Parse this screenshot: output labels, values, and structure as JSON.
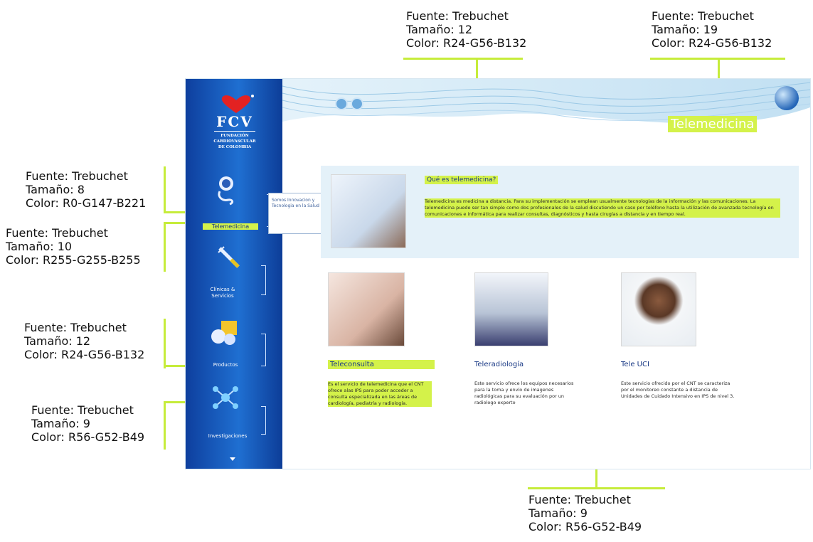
{
  "annotations": [
    {
      "id": "a1",
      "lines": [
        "Fuente: Trebuchet",
        "Tamaño: 12",
        "Color: R24-G56-B132"
      ]
    },
    {
      "id": "a2",
      "lines": [
        "Fuente: Trebuchet",
        "Tamaño: 19",
        "Color: R24-G56-B132"
      ]
    },
    {
      "id": "a3",
      "lines": [
        "Fuente: Trebuchet",
        "Tamaño: 8",
        "Color: R0-G147-B221"
      ]
    },
    {
      "id": "a4",
      "lines": [
        "Fuente: Trebuchet",
        "Tamaño: 10",
        "Color: R255-G255-B255"
      ]
    },
    {
      "id": "a5",
      "lines": [
        "Fuente: Trebuchet",
        "Tamaño: 12",
        "Color: R24-G56-B132"
      ]
    },
    {
      "id": "a6",
      "lines": [
        "Fuente: Trebuchet",
        "Tamaño: 9",
        "Color: R56-G52-B49"
      ]
    },
    {
      "id": "a7",
      "lines": [
        "Fuente: Trebuchet",
        "Tamaño: 9",
        "Color: R56-G52-B49"
      ]
    }
  ],
  "logo": {
    "name": "FCV",
    "subtitle": [
      "FUNDACIÓN",
      "CARDIOVASCULAR",
      "DE COLOMBIA"
    ]
  },
  "nav": [
    {
      "label": "Telemedicina",
      "icon": "stethoscope-icon"
    },
    {
      "label": "Clínicas & Servicios",
      "icon": "syringe-icon"
    },
    {
      "label": "Productos",
      "icon": "medicine-box-icon"
    },
    {
      "label": "Investigaciones",
      "icon": "molecule-icon"
    }
  ],
  "tooltip": "Somos Innovacion y Tecnologia en la Salud",
  "header": {
    "title": "Telemedicina",
    "icons": [
      "help-icon",
      "info-icon"
    ]
  },
  "intro": {
    "heading": "Qué es telemedicina?",
    "body": "Telemedicina es medicina a distancia. Para su implementación se emplean usualmente tecnologías de la información y las comunicaciones. La telemedicina puede ser tan simple como dos profesionales de la salud discutiendo un caso por teléfono hasta la utilización de avanzada tecnología en comunicaciones e informática para realizar consultas, diagnósticos y hasta cirugías a distancia y en tiempo real."
  },
  "services": [
    {
      "title": "Teleconsulta",
      "body": "Es el servicio de telemedicina que el CNT ofrece alas IPS para poder acceder a consulta especializada en las áreas de cardiología, pediatría y radiología.",
      "highlight": true
    },
    {
      "title": "Teleradiología",
      "body": "Este servicio ofrece los equipos necesarios para la toma y envío de imagenes radiológicas para su evaluación por un radiologo experto",
      "highlight": false
    },
    {
      "title": "Tele UCI",
      "body": "Este servicio ofrecido por el CNT se caracteriza por el monitoreo constante a distancia de Unidades de Cuidado Intensivo en IPS de nivel 3.",
      "highlight": false
    }
  ],
  "colors": {
    "accent": "#d4f24a",
    "annotationLine": "#c6ec3b",
    "sidebar": "#1f6fd1",
    "titleBlue": "#183884"
  }
}
